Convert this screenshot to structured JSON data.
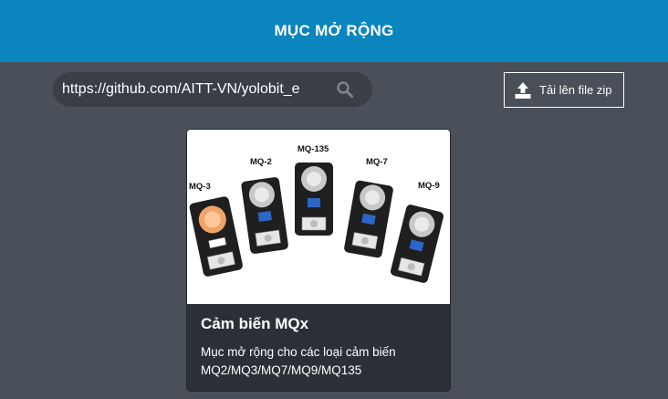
{
  "header": {
    "title": "MỤC MỞ RỘNG"
  },
  "search": {
    "value": "https://github.com/AITT-VN/yolobit_e"
  },
  "upload": {
    "label": "Tải lên file zip"
  },
  "card": {
    "title": "Cảm biến MQx",
    "description": "Mục mở rộng cho các loại cảm biến MQ2/MQ3/MQ7/MQ9/MQ135",
    "sensor_labels": [
      "MQ-3",
      "MQ-2",
      "MQ-135",
      "MQ-7",
      "MQ-9"
    ]
  }
}
